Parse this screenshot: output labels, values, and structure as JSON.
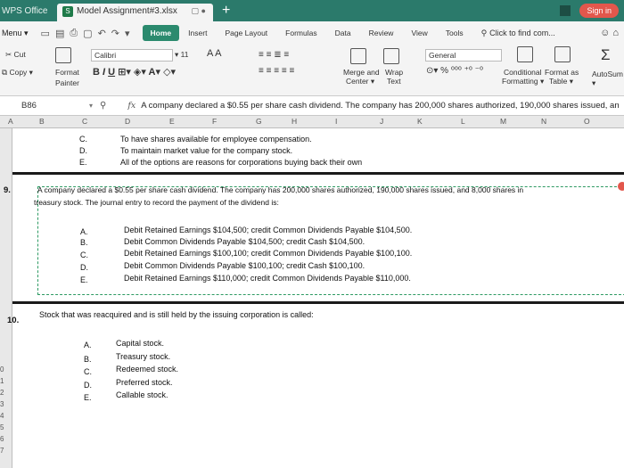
{
  "titlebar": {
    "app_name": "WPS Office",
    "doc_tab": "Model Assignment#3.xlsx",
    "sign_in": "Sign in"
  },
  "menu": {
    "menu_label": "Menu",
    "tabs": [
      "Home",
      "Insert",
      "Page Layout",
      "Formulas",
      "Data",
      "Review",
      "View",
      "Tools"
    ],
    "active_tab": "Home",
    "find_label": "Click to find com..."
  },
  "ribbon": {
    "cut": "Cut",
    "copy": "Copy",
    "format_painter_1": "Format",
    "format_painter_2": "Painter",
    "font_name": "Calibri",
    "font_size": "11",
    "merge_1": "Merge and",
    "merge_2": "Center",
    "wrap_1": "Wrap",
    "wrap_2": "Text",
    "number_format": "General",
    "cond_1": "Conditional",
    "cond_2": "Formatting",
    "fmt_table_1": "Format as",
    "fmt_table_2": "Table",
    "autosum": "AutoSum"
  },
  "formula_bar": {
    "name_box": "B86",
    "fx": "fx",
    "content": "A company declared a $0.55 per share cash dividend. The company has 200,000 shares authorized, 190,000 shares issued, an"
  },
  "columns": [
    "A",
    "B",
    "C",
    "D",
    "E",
    "F",
    "G",
    "H",
    "I",
    "J",
    "K",
    "L",
    "M",
    "N",
    "O"
  ],
  "row_numbers_visible": [
    "0",
    "1",
    "2",
    "3",
    "4",
    "5",
    "6",
    "7"
  ],
  "prev_question": {
    "options": [
      {
        "letter": "C.",
        "text": "To have shares available for employee compensation."
      },
      {
        "letter": "D.",
        "text": "To maintain market value for the company stock."
      },
      {
        "letter": "E.",
        "text": "All of the options are reasons for corporations buying back their own"
      }
    ]
  },
  "question_9": {
    "number": "9.",
    "line1": "A company declared a $0.55 per share cash dividend. The company has 200,000 shares authorized, 190,000 shares issued, and 8,000 shares in",
    "line2": "treasury stock. The journal entry to record the payment of the dividend is:",
    "options": [
      {
        "letter": "A.",
        "text": "Debit Retained Earnings $104,500; credit Common Dividends Payable $104,500."
      },
      {
        "letter": "B.",
        "text": "Debit Common Dividends Payable $104,500; credit Cash $104,500."
      },
      {
        "letter": "C.",
        "text": "Debit Retained Earnings $100,100; credit Common Dividends Payable $100,100."
      },
      {
        "letter": "D.",
        "text": "Debit Common Dividends Payable $100,100; credit Cash $100,100."
      },
      {
        "letter": "E.",
        "text": "Debit Retained Earnings $110,000; credit Common Dividends Payable $110,000."
      }
    ]
  },
  "question_10": {
    "number": "10.",
    "text": "Stock that was reacquired and is still held by the issuing corporation is called:",
    "options": [
      {
        "letter": "A.",
        "text": "Capital stock."
      },
      {
        "letter": "B.",
        "text": "Treasury stock."
      },
      {
        "letter": "C.",
        "text": "Redeemed stock."
      },
      {
        "letter": "D.",
        "text": "Preferred stock."
      },
      {
        "letter": "E.",
        "text": "Callable stock."
      }
    ]
  },
  "colors": {
    "titlebar": "#2b7a6b",
    "active_tab": "#2b8a6e",
    "selection": "#2e9a63",
    "sign_in": "#e2574c"
  }
}
